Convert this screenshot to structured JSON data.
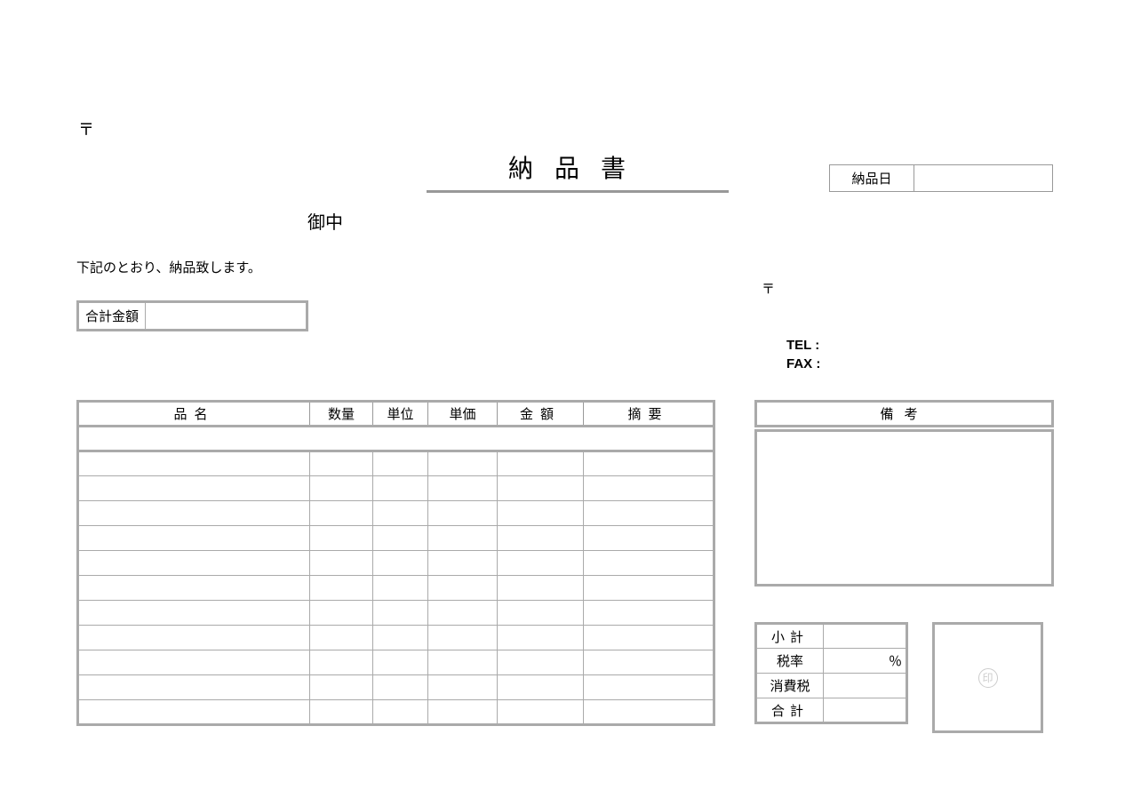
{
  "postal_mark": "〒",
  "title": "納品書",
  "delivery_date": {
    "label": "納品日",
    "value": ""
  },
  "recipient_suffix": "御中",
  "intro": "下記のとおり、納品致します。",
  "total": {
    "label": "合計金額",
    "value": ""
  },
  "postal_mark_right": "〒",
  "contact": {
    "tel_label": "TEL :",
    "fax_label": "FAX :"
  },
  "items": {
    "headers": {
      "name": "品名",
      "qty": "数量",
      "unit": "単位",
      "price": "単価",
      "amount": "金額",
      "note": "摘要"
    },
    "row_count": 11
  },
  "remarks": {
    "header": "備考"
  },
  "summary": {
    "subtotal_label": "小計",
    "tax_rate_label": "税率",
    "tax_rate_unit": "％",
    "tax_label": "消費税",
    "total_label": "合計"
  },
  "stamp": {
    "mark": "印"
  }
}
